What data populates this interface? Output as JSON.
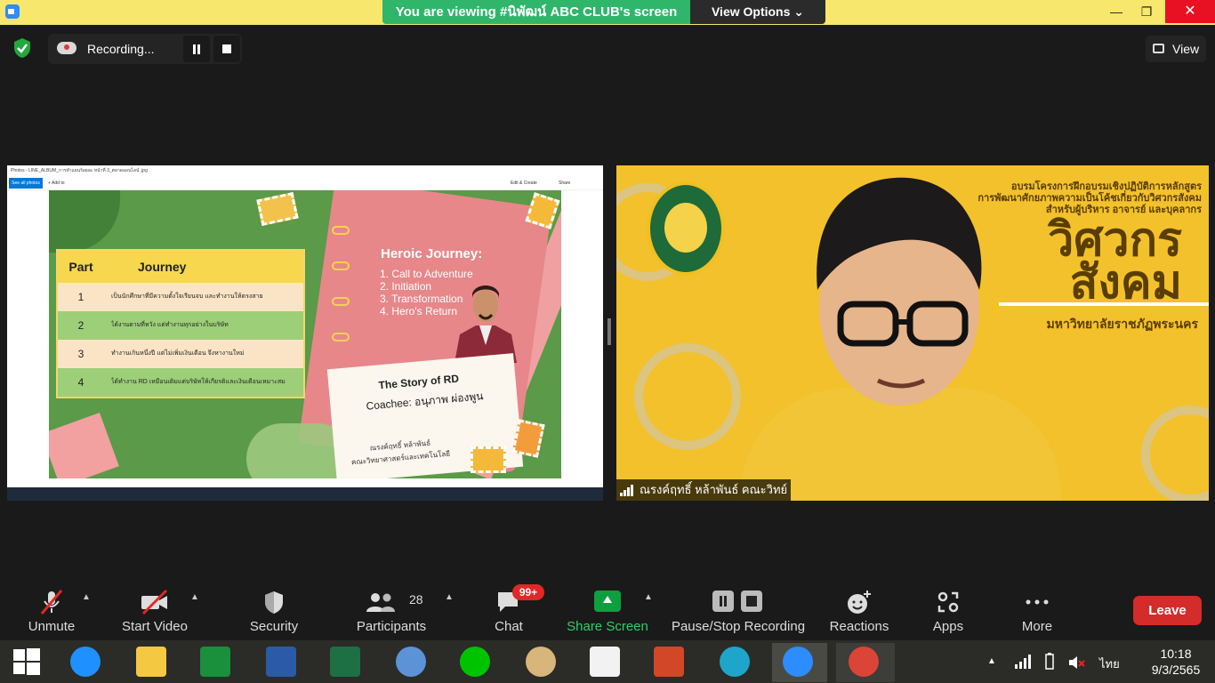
{
  "banner": {
    "viewing": "You are viewing #นิพัฒน์ ABC CLUB's screen",
    "view_options": "View Options"
  },
  "window_controls": {
    "minimize": "—",
    "maximize": "❐",
    "close": "✕"
  },
  "recording": {
    "label": "Recording..."
  },
  "view_button": {
    "label": "View"
  },
  "shared_screen": {
    "window_title": "Photos - LINE_ALBUM_การทำแผนร้อยละ หน้าที่ 3_ตลาดออนไลน์ .jpg",
    "see_all": "See all photos",
    "add_to": "+ Add to",
    "edit_create": "Edit & Create",
    "share": "Share",
    "slide": {
      "table_headers": {
        "part": "Part",
        "journey": "Journey"
      },
      "rows": [
        {
          "num": "1",
          "text": "เป็นนักศึกษาที่มีความตั้งใจเรียนจบ และทำงานให้ตรงสาย"
        },
        {
          "num": "2",
          "text": "ได้งานตามที่หวัง แต่ทำงานทุกอย่างในบริษัท"
        },
        {
          "num": "3",
          "text": "ทำงานเกินหนึ่งปี แต่ไม่เพิ่มเงินเดือน จึงหางานใหม่"
        },
        {
          "num": "4",
          "text": "ได้ทำงาน RD เหมือนเดิมแต่บริษัทให้เกียรติและเงินเดือนเหมาะสม"
        }
      ],
      "heroic_title": "Heroic Journey:",
      "heroic_steps": [
        "1. Call to Adventure",
        "2. Initiation",
        "3. Transformation",
        "4. Hero's Return"
      ],
      "story_title": "The Story of RD",
      "coachee": "Coachee: อนุภาพ ผ่องพูน",
      "author": "ณรงค์ฤทธิ์ หล้าพันธ์",
      "faculty": "คณะวิทยาศาสตร์และเทคโนโลยี"
    }
  },
  "video": {
    "banner_line1": "อบรมโครงการฝึกอบรมเชิงปฏิบัติการหลักสูตร",
    "banner_line2": "การพัฒนาศักยภาพความเป็นโค้ชเกี่ยวกับวิศวกรสังคม",
    "banner_line3": "สำหรับผู้บริหาร อาจารย์ และบุคลากร",
    "banner_big1": "วิศวกร",
    "banner_big2": "สังคม",
    "university": "มหาวิทยาลัยราชภัฏพระนคร",
    "name_tag": "ณรงค์ฤทธิ์ หล้าพันธ์ คณะวิทย์"
  },
  "toolbar": {
    "unmute": "Unmute",
    "start_video": "Start Video",
    "security": "Security",
    "participants": "Participants",
    "participants_count": "28",
    "chat": "Chat",
    "chat_badge": "99+",
    "share_screen": "Share Screen",
    "pause_stop": "Pause/Stop Recording",
    "reactions": "Reactions",
    "apps": "Apps",
    "more": "More",
    "leave": "Leave"
  },
  "taskbar": {
    "lang": "ไทย",
    "time": "10:18",
    "date": "9/3/2565"
  },
  "colors": {
    "zoom_blue": "#2d8cff",
    "share_green": "#0e9f3e",
    "leave_red": "#d42b2b",
    "banner_green": "#2fb66b"
  }
}
